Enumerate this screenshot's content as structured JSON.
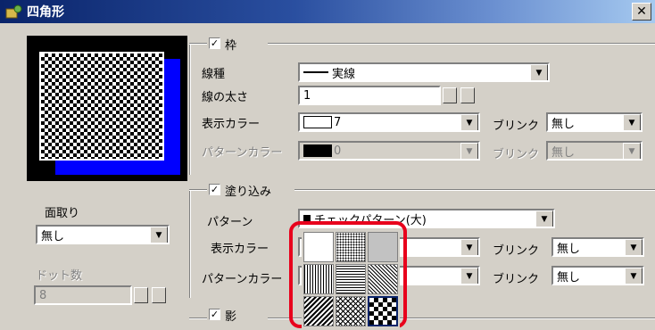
{
  "window": {
    "title": "四角形",
    "close_glyph": "✕"
  },
  "frame": {
    "checkbox_label": "枠",
    "line_type_label": "線種",
    "line_type_value": "実線",
    "line_width_label": "線の太さ",
    "line_width_value": "1",
    "display_color_label": "表示カラー",
    "display_color_value": "7",
    "blink_label": "ブリンク",
    "blink_value": "無し",
    "pattern_color_label": "パターンカラー",
    "pattern_color_value": "0",
    "pattern_blink_label": "ブリンク",
    "pattern_blink_value": "無し"
  },
  "fill": {
    "checkbox_label": "塗り込み",
    "pattern_label": "パターン",
    "pattern_value": "チェックパターン(大)",
    "display_color_label": "表示カラー",
    "blink_label": "ブリンク",
    "blink_value": "無し",
    "pattern_color_label": "パターンカラー",
    "pattern_blink_label": "ブリンク",
    "pattern_blink_value": "無し"
  },
  "shadow": {
    "checkbox_label": "影"
  },
  "left": {
    "chamfer_label": "面取り",
    "chamfer_value": "無し",
    "dot_count_label": "ドット数",
    "dot_count_value": "8"
  },
  "pattern_palette": {
    "patterns": [
      "white",
      "dots-fine",
      "dots-dense",
      "vertical-lines",
      "horizontal-lines",
      "diagonal-lines",
      "diagonal-bold",
      "crosshatch",
      "checker-large"
    ],
    "selected": "checker-large",
    "highlight_color": "#e8001c"
  },
  "colors": {
    "title_bar": "#0a246a",
    "dialog_bg": "#d4d0c8",
    "preview_border": "#0000ff"
  }
}
